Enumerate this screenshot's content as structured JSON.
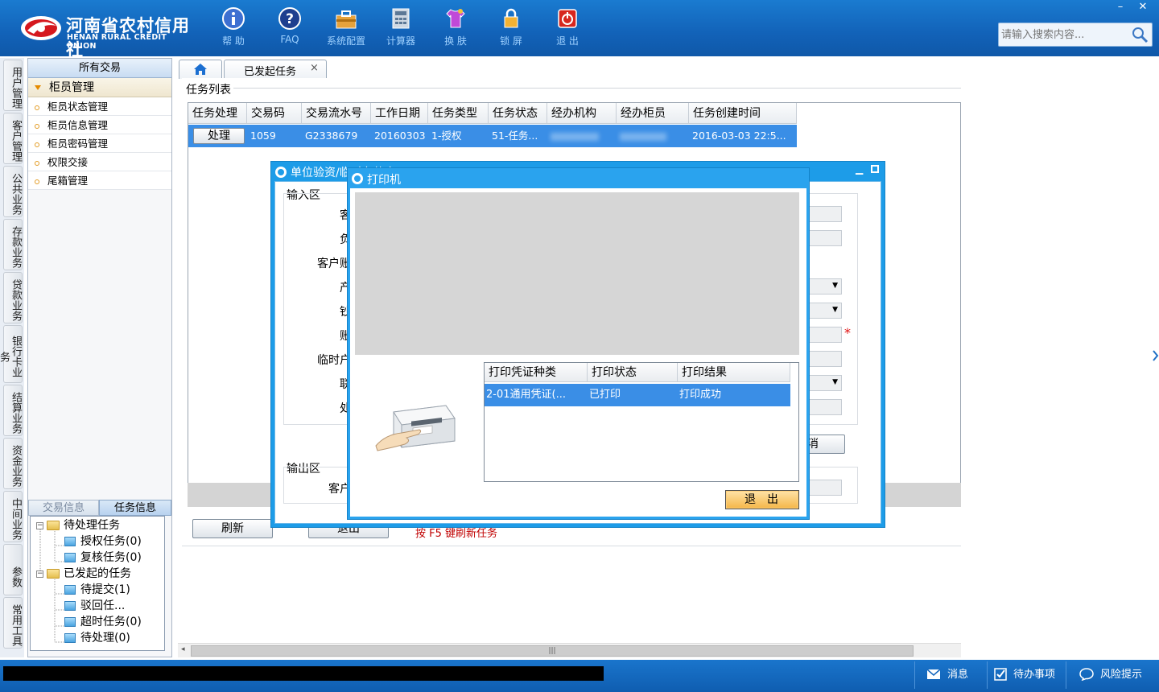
{
  "header": {
    "logo_cn": "河南省农村信用社",
    "logo_en": "HENAN RURAL CREDIT UNION",
    "tools": [
      {
        "label": "帮 助",
        "icon": "info-icon"
      },
      {
        "label": "FAQ",
        "icon": "question-icon"
      },
      {
        "label": "系统配置",
        "icon": "toolbox-icon"
      },
      {
        "label": "计算器",
        "icon": "calculator-icon"
      },
      {
        "label": "换 肤",
        "icon": "shirt-icon"
      },
      {
        "label": "锁 屏",
        "icon": "lock-icon"
      },
      {
        "label": "退 出",
        "icon": "power-icon"
      }
    ],
    "search_placeholder": "请输入搜索内容...",
    "win_min": "–",
    "win_close": "✕"
  },
  "vtabs": [
    "用户管理",
    "客户管理",
    "公共业务",
    "存款业务",
    "贷款业务",
    "银行卡业务",
    "结算业务",
    "资金业务",
    "中间业务",
    "参数",
    "常用工具"
  ],
  "leftpanel": {
    "title": "所有交易",
    "group": "柜员管理",
    "items": [
      "柜员状态管理",
      "柜员信息管理",
      "柜员密码管理",
      "权限交接",
      "尾箱管理"
    ],
    "bottom_tabs": [
      "交易信息",
      "任务信息"
    ],
    "tree": {
      "pending_root": "待处理任务",
      "pending_children": [
        "授权任务(0)",
        "复核任务(0)"
      ],
      "initiated_root": "已发起的任务",
      "initiated_children": [
        "待提交(1)",
        "驳回任...",
        "超时任务(0)",
        "待处理(0)"
      ],
      "expand_minus": "−"
    }
  },
  "tabs": {
    "home_icon": "home-icon",
    "active_tab": "已发起任务",
    "close": "×"
  },
  "main": {
    "section_title": "任务列表",
    "columns": [
      "任务处理",
      "交易码",
      "交易流水号",
      "工作日期",
      "任务类型",
      "任务状态",
      "经办机构",
      "经办柜员",
      "任务创建时间"
    ],
    "row": {
      "action": "处理",
      "trade_code": "1059",
      "serial": "G2338679",
      "work_date": "20160303",
      "task_type": "1-授权",
      "task_status": "51-任务...",
      "org": "",
      "teller": "",
      "created": "2016-03-03 22:5..."
    },
    "refresh": "刷新",
    "exit": "退出",
    "hint": "按  F5  键刷新任务"
  },
  "dialog1": {
    "title": "单位验资/临时存款户",
    "input_section": "输入区",
    "output_section": "输出区",
    "labels": [
      "客",
      "负",
      "客户账",
      "产",
      "钞",
      "账",
      "临时户",
      "联",
      "处"
    ],
    "output_label": "客户",
    "required_mark": "*",
    "cancel_partial": "消"
  },
  "dialog2": {
    "title": "打印机",
    "columns": [
      "打印凭证种类",
      "打印状态",
      "打印结果"
    ],
    "row": {
      "type": "2-01通用凭证(...",
      "status": "已打印",
      "result": "打印成功"
    },
    "exit": "退出"
  },
  "statusbar": {
    "messages": "消息",
    "todo": "待办事项",
    "risk": "风险提示"
  },
  "hscroll_grip": "|||"
}
